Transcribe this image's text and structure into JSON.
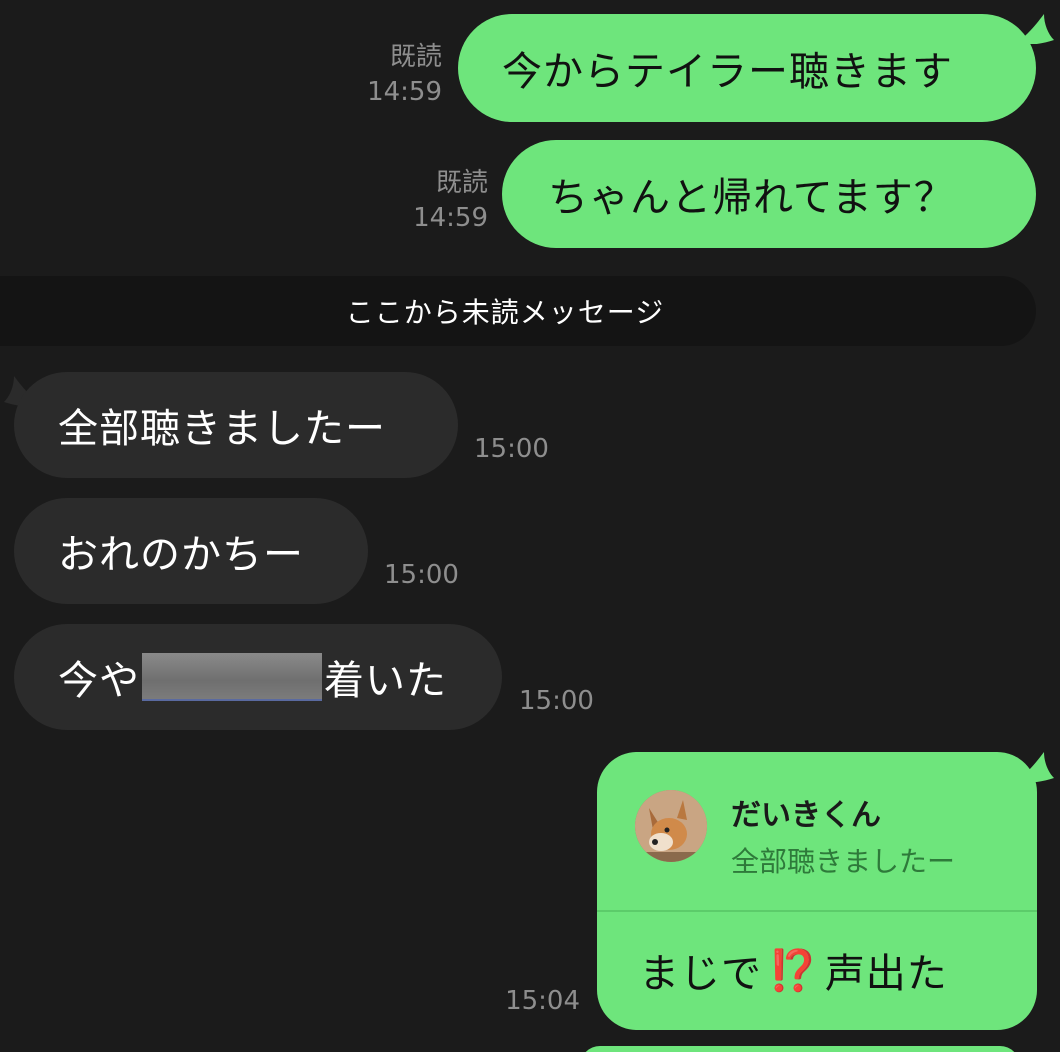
{
  "messages_out": [
    {
      "text": "今からテイラー聴きます",
      "read": "既読",
      "time": "14:59"
    },
    {
      "text": "ちゃんと帰れてます？",
      "read": "既読",
      "time": "14:59"
    }
  ],
  "unread_divider": "ここから未読メッセージ",
  "messages_in": [
    {
      "text": "全部聴きましたー",
      "time": "15:00"
    },
    {
      "text": "おれのかちー",
      "time": "15:00"
    },
    {
      "text_before": "今や",
      "text_after": "着いた",
      "time": "15:00"
    }
  ],
  "reply": {
    "quoted_name": "だいきくん",
    "quoted_text": "全部聴きましたー",
    "body_before": "まじで",
    "emoji": "⁉️",
    "body_after": "声出た",
    "time": "15:04"
  },
  "colors": {
    "background": "#1b1b1b",
    "outgoing_bubble": "#6ee57c",
    "incoming_bubble": "#2b2b2b",
    "meta_text": "#8e8e8e"
  }
}
